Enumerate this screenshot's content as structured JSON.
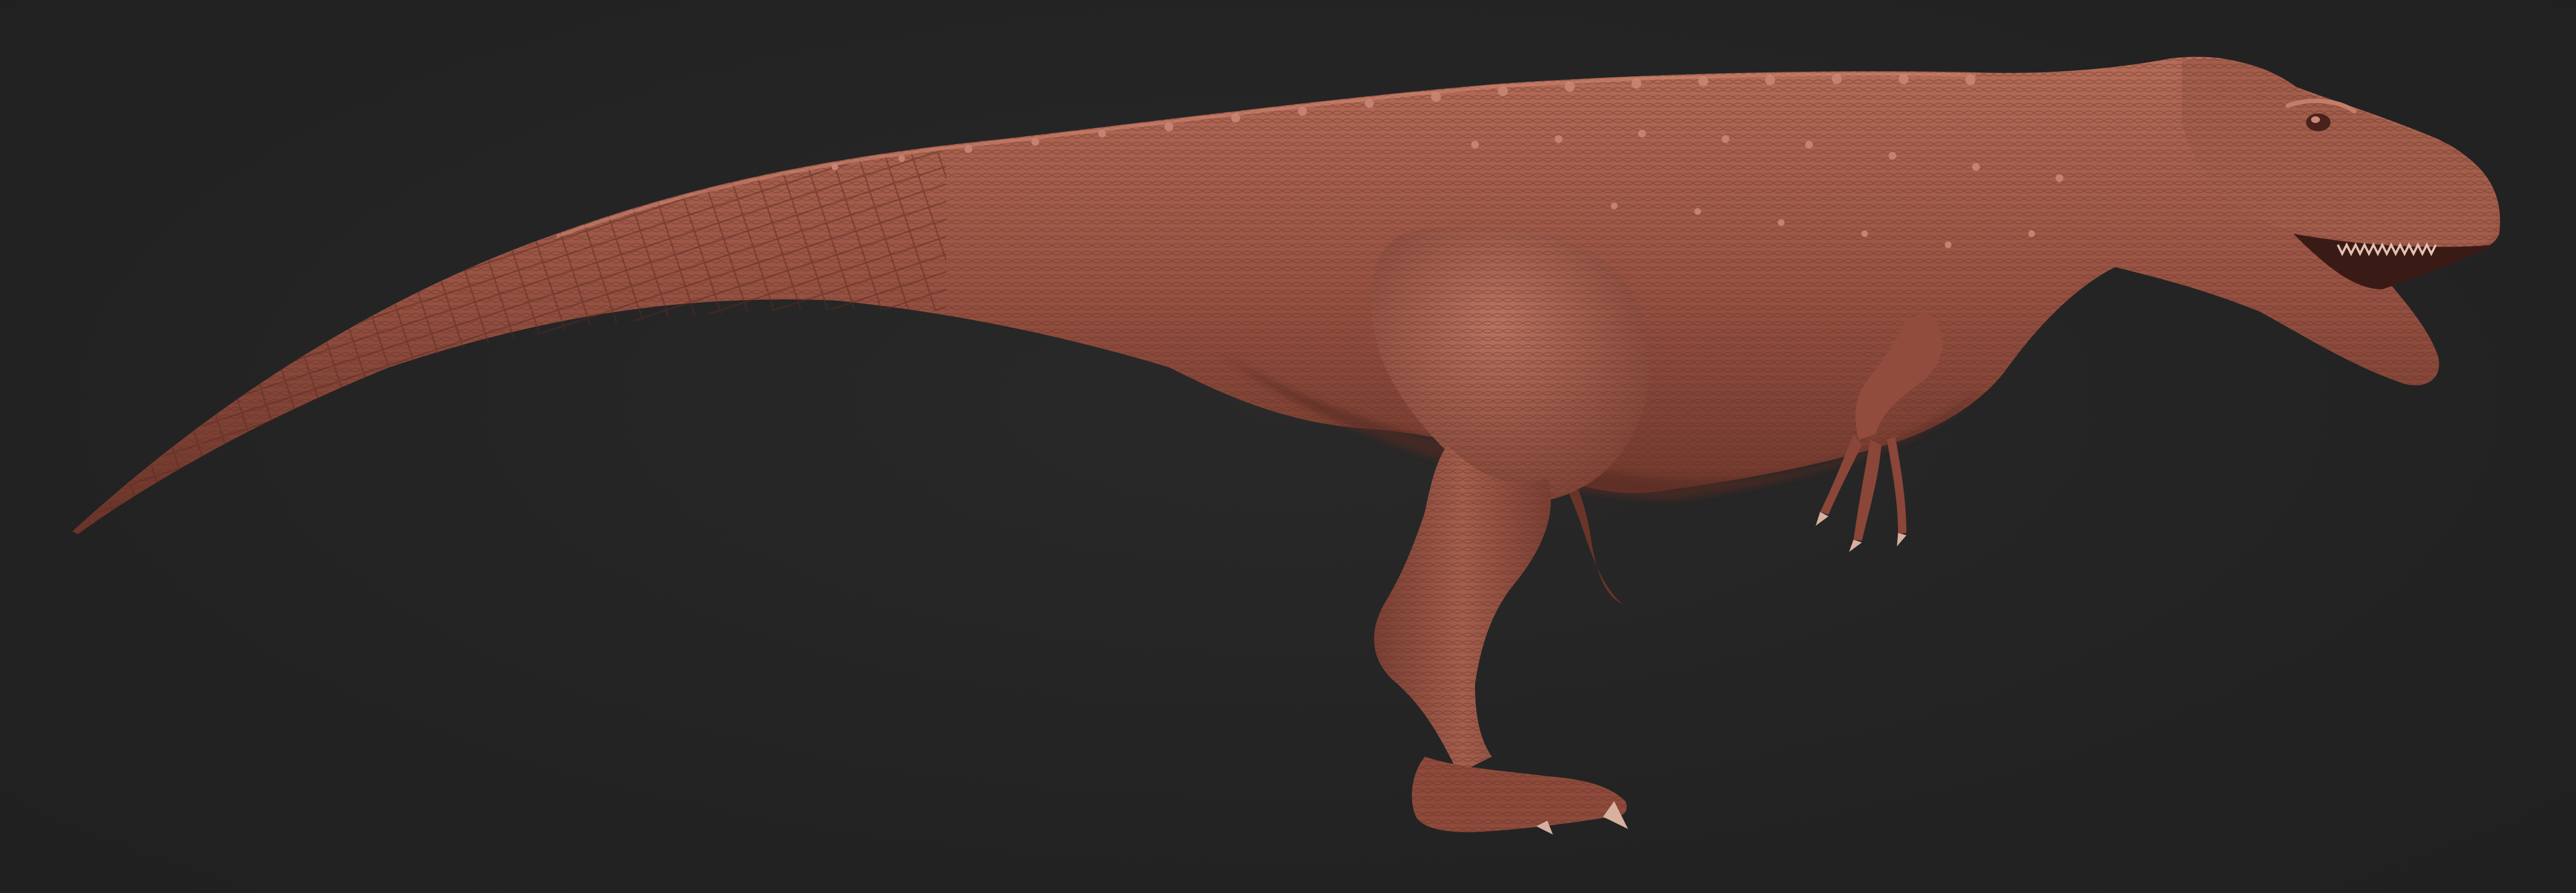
{
  "scene": {
    "subject_icon": "theropod-dinosaur-sculpt",
    "colors": {
      "background": "#232323",
      "skin_base": "#9a5444",
      "skin_light": "#c27a66",
      "skin_dark": "#5e2e24",
      "claw": "#d8b0a0"
    }
  }
}
